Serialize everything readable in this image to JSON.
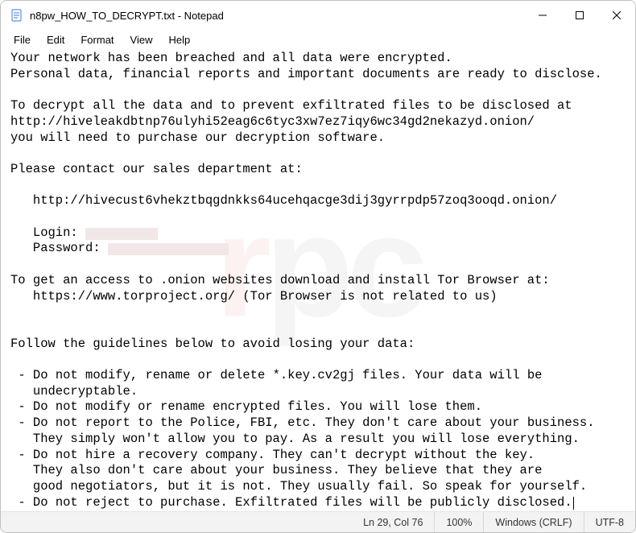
{
  "window": {
    "title": "n8pw_HOW_TO_DECRYPT.txt - Notepad"
  },
  "menu": {
    "file": "File",
    "edit": "Edit",
    "format": "Format",
    "view": "View",
    "help": "Help"
  },
  "content": {
    "l01": "Your network has been breached and all data were encrypted.",
    "l02": "Personal data, financial reports and important documents are ready to disclose.",
    "l03": "",
    "l04": "To decrypt all the data and to prevent exfiltrated files to be disclosed at ",
    "l05": "http://hiveleakdbtnp76ulyhi52eag6c6tyc3xw7ez7iqy6wc34gd2nekazyd.onion/",
    "l06": "you will need to purchase our decryption software.",
    "l07": "",
    "l08": "Please contact our sales department at:",
    "l09": "",
    "l10": "   http://hivecust6vhekztbqgdnkks64ucehqacge3dij3gyrrpdp57zoq3ooqd.onion/",
    "l11": "",
    "l12": "   Login: ",
    "l13": "   Password: ",
    "l14": "",
    "l15": "To get an access to .onion websites download and install Tor Browser at:",
    "l16": "   https://www.torproject.org/ (Tor Browser is not related to us)",
    "l17": "",
    "l18": "",
    "l19": "Follow the guidelines below to avoid losing your data:",
    "l20": "",
    "l21": " - Do not modify, rename or delete *.key.cv2gj files. Your data will be ",
    "l22": "   undecryptable.",
    "l23": " - Do not modify or rename encrypted files. You will lose them.",
    "l24": " - Do not report to the Police, FBI, etc. They don't care about your business.",
    "l25": "   They simply won't allow you to pay. As a result you will lose everything.",
    "l26": " - Do not hire a recovery company. They can't decrypt without the key.  ",
    "l27": "   They also don't care about your business. They believe that they are ",
    "l28": "   good negotiators, but it is not. They usually fail. So speak for yourself.",
    "l29": " - Do not reject to purchase. Exfiltrated files will be publicly disclosed."
  },
  "status": {
    "pos": "Ln 29, Col 76",
    "zoom": "100%",
    "eol": "Windows (CRLF)",
    "enc": "UTF-8"
  }
}
